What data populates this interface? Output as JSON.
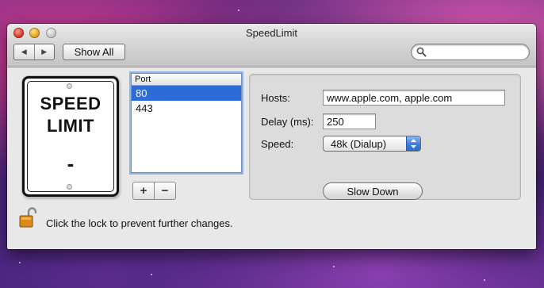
{
  "window": {
    "title": "SpeedLimit"
  },
  "toolbar": {
    "back_icon": "triangle-left",
    "forward_icon": "triangle-right",
    "show_all_label": "Show All",
    "search_value": ""
  },
  "sign": {
    "line1": "SPEED",
    "line2": "LIMIT",
    "value": "-"
  },
  "ports": {
    "header": "Port",
    "items": [
      "80",
      "443"
    ],
    "selected": "80",
    "add_label": "+",
    "remove_label": "−"
  },
  "settings": {
    "hosts_label": "Hosts:",
    "hosts_value": "www.apple.com, apple.com",
    "delay_label": "Delay (ms):",
    "delay_value": "250",
    "speed_label": "Speed:",
    "speed_value": "48k (Dialup)",
    "action_label": "Slow Down"
  },
  "lock": {
    "text": "Click the lock to prevent further changes.",
    "state": "unlocked"
  },
  "colors": {
    "selection": "#2d6bd6",
    "popup_accent": "#3b7ee0"
  }
}
